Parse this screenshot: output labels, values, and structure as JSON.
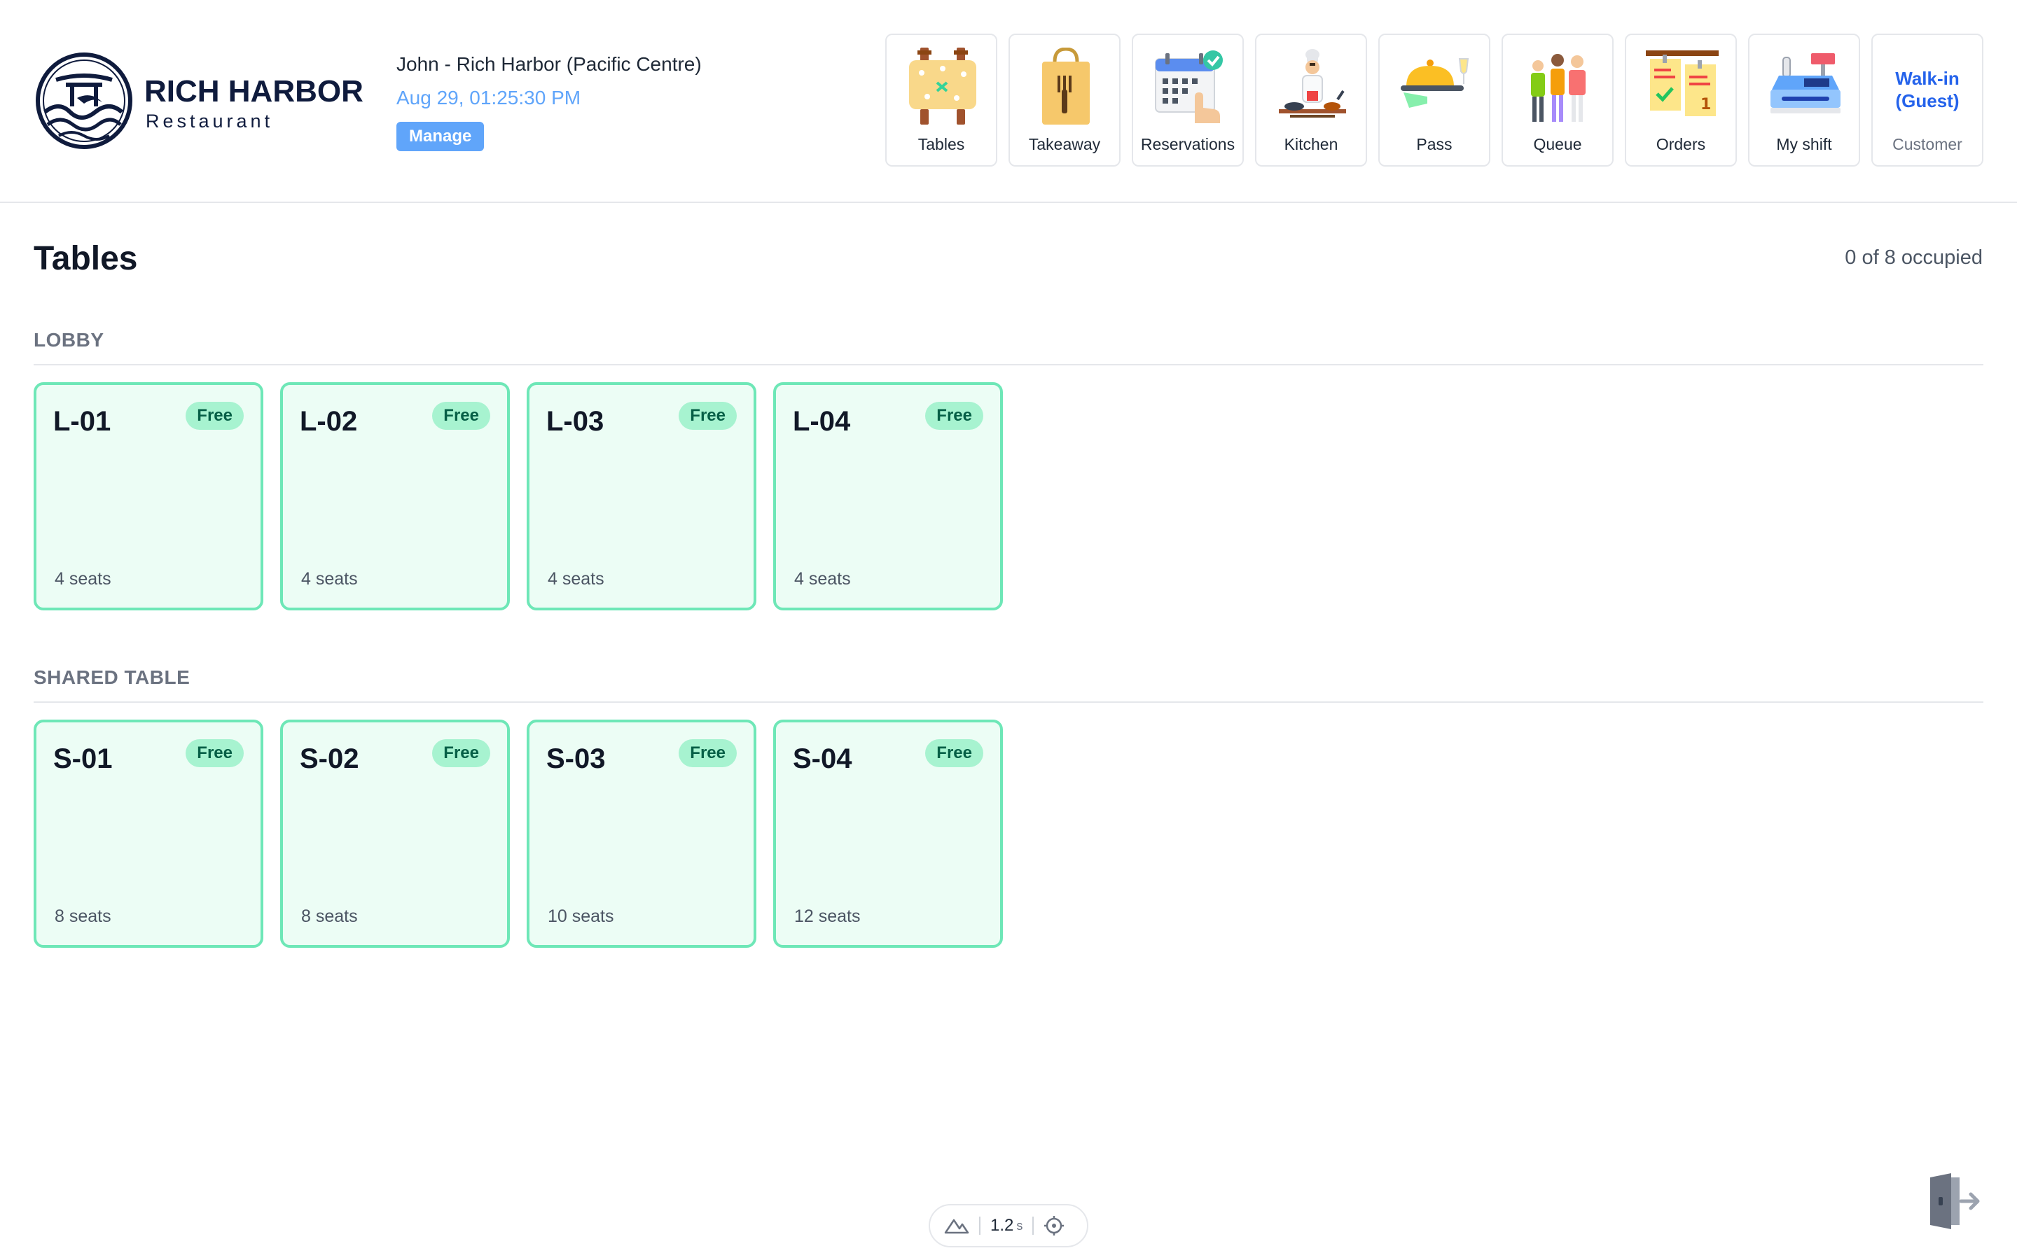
{
  "brand": {
    "name": "RICH HARBOR",
    "subtitle": "Restaurant"
  },
  "session": {
    "user_line": "John - Rich Harbor (Pacific Centre)",
    "datetime": "Aug 29, 01:25:30 PM",
    "manage_label": "Manage"
  },
  "nav": {
    "tables": "Tables",
    "takeaway": "Takeaway",
    "reservations": "Reservations",
    "kitchen": "Kitchen",
    "pass": "Pass",
    "queue": "Queue",
    "orders": "Orders",
    "my_shift": "My shift",
    "customer_name": "Walk-in (Guest)",
    "customer_label": "Customer"
  },
  "page": {
    "title": "Tables",
    "occupied": "0 of 8 occupied"
  },
  "sections": [
    {
      "title": "LOBBY",
      "tables": [
        {
          "name": "L-01",
          "status": "Free",
          "seats": "4 seats"
        },
        {
          "name": "L-02",
          "status": "Free",
          "seats": "4 seats"
        },
        {
          "name": "L-03",
          "status": "Free",
          "seats": "4 seats"
        },
        {
          "name": "L-04",
          "status": "Free",
          "seats": "4 seats"
        }
      ]
    },
    {
      "title": "SHARED TABLE",
      "tables": [
        {
          "name": "S-01",
          "status": "Free",
          "seats": "8 seats"
        },
        {
          "name": "S-02",
          "status": "Free",
          "seats": "8 seats"
        },
        {
          "name": "S-03",
          "status": "Free",
          "seats": "10 seats"
        },
        {
          "name": "S-04",
          "status": "Free",
          "seats": "12 seats"
        }
      ]
    }
  ],
  "dev_toolbar": {
    "value": "1.2",
    "unit": "s"
  },
  "colors": {
    "accent": "#60a5fa",
    "free_border": "#6ee7b7",
    "free_bg": "#ecfdf5",
    "brand": "#0f1b3d"
  }
}
